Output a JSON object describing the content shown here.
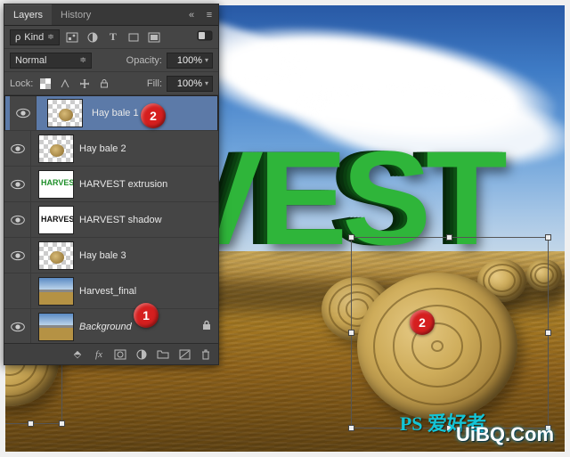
{
  "panel": {
    "tabs": {
      "layers": "Layers",
      "history": "History"
    },
    "filter": {
      "kind_label": "Kind"
    },
    "blend": {
      "mode": "Normal",
      "opacity_label": "Opacity:",
      "opacity_value": "100%"
    },
    "lock": {
      "label": "Lock:",
      "fill_label": "Fill:",
      "fill_value": "100%"
    },
    "layers": [
      {
        "name": "Hay bale 1",
        "visible": true,
        "selected": true,
        "thumb": "bale",
        "locked": false
      },
      {
        "name": "Hay bale 2",
        "visible": true,
        "selected": false,
        "thumb": "bale",
        "locked": false
      },
      {
        "name": "HARVEST extrusion",
        "visible": true,
        "selected": false,
        "thumb": "text-green",
        "locked": false
      },
      {
        "name": "HARVEST shadow",
        "visible": true,
        "selected": false,
        "thumb": "text-shadow",
        "locked": false
      },
      {
        "name": "Hay bale 3",
        "visible": true,
        "selected": false,
        "thumb": "bale",
        "locked": false
      },
      {
        "name": "Harvest_final",
        "visible": false,
        "selected": false,
        "thumb": "scene",
        "locked": false
      },
      {
        "name": "Background",
        "visible": true,
        "selected": false,
        "thumb": "scene",
        "locked": true,
        "italic": true
      }
    ]
  },
  "callouts": {
    "c1": "1",
    "c2": "2",
    "c3": "2"
  },
  "canvas": {
    "headline": "VEST"
  },
  "watermark": {
    "a": "PS 爱好者",
    "b": "UiBQ.Com"
  }
}
